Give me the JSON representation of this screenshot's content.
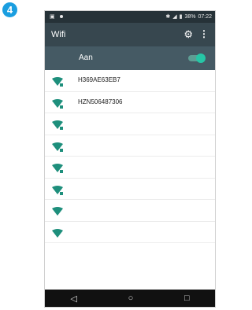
{
  "step": {
    "number": "4"
  },
  "status_bar": {
    "battery": "38%",
    "time": "07:22"
  },
  "app_bar": {
    "title": "Wifi"
  },
  "wifi_toggle": {
    "label": "Aan",
    "on": true
  },
  "networks": [
    {
      "ssid": "H369AE63EB7",
      "icon": "wifi-secured-icon"
    },
    {
      "ssid": "HZN506487306",
      "icon": "wifi-secured-icon"
    },
    {
      "ssid": "",
      "icon": "wifi-secured-icon"
    },
    {
      "ssid": "",
      "icon": "wifi-secured-icon"
    },
    {
      "ssid": "",
      "icon": "wifi-secured-icon"
    },
    {
      "ssid": "",
      "icon": "wifi-secured-icon"
    },
    {
      "ssid": "",
      "icon": "wifi-icon"
    },
    {
      "ssid": "",
      "icon": "wifi-icon"
    }
  ],
  "colors": {
    "accent": "#26c6a6",
    "wifi": "#1e8f7c",
    "step_badge": "#1a9ee0"
  }
}
